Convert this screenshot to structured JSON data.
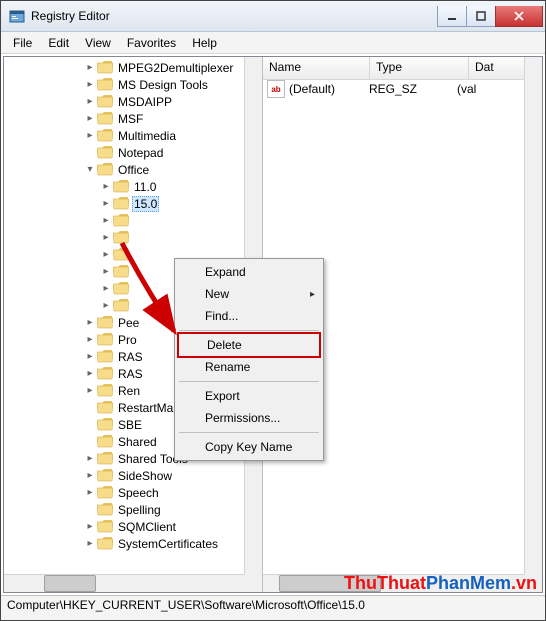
{
  "window": {
    "title": "Registry Editor"
  },
  "menubar": [
    "File",
    "Edit",
    "View",
    "Favorites",
    "Help"
  ],
  "tree": {
    "items": [
      {
        "depth": 5,
        "exp": "closed",
        "label": "MPEG2Demultiplexer"
      },
      {
        "depth": 5,
        "exp": "closed",
        "label": "MS Design Tools"
      },
      {
        "depth": 5,
        "exp": "closed",
        "label": "MSDAIPP"
      },
      {
        "depth": 5,
        "exp": "closed",
        "label": "MSF"
      },
      {
        "depth": 5,
        "exp": "closed",
        "label": "Multimedia"
      },
      {
        "depth": 5,
        "exp": "none",
        "label": "Notepad"
      },
      {
        "depth": 5,
        "exp": "open",
        "label": "Office"
      },
      {
        "depth": 6,
        "exp": "closed",
        "label": "11.0"
      },
      {
        "depth": 6,
        "exp": "closed",
        "label": "15.0",
        "selected": true
      },
      {
        "depth": 6,
        "exp": "closed",
        "label": ""
      },
      {
        "depth": 6,
        "exp": "closed",
        "label": ""
      },
      {
        "depth": 6,
        "exp": "closed",
        "label": ""
      },
      {
        "depth": 6,
        "exp": "closed",
        "label": ""
      },
      {
        "depth": 6,
        "exp": "closed",
        "label": ""
      },
      {
        "depth": 6,
        "exp": "closed",
        "label": ""
      },
      {
        "depth": 5,
        "exp": "closed",
        "label": "Pee"
      },
      {
        "depth": 5,
        "exp": "closed",
        "label": "Pro"
      },
      {
        "depth": 5,
        "exp": "closed",
        "label": "RAS"
      },
      {
        "depth": 5,
        "exp": "closed",
        "label": "RAS"
      },
      {
        "depth": 5,
        "exp": "closed",
        "label": "Ren"
      },
      {
        "depth": 5,
        "exp": "none",
        "label": "RestartManager"
      },
      {
        "depth": 5,
        "exp": "none",
        "label": "SBE"
      },
      {
        "depth": 5,
        "exp": "none",
        "label": "Shared"
      },
      {
        "depth": 5,
        "exp": "closed",
        "label": "Shared Tools"
      },
      {
        "depth": 5,
        "exp": "closed",
        "label": "SideShow"
      },
      {
        "depth": 5,
        "exp": "closed",
        "label": "Speech"
      },
      {
        "depth": 5,
        "exp": "none",
        "label": "Spelling"
      },
      {
        "depth": 5,
        "exp": "closed",
        "label": "SQMClient"
      },
      {
        "depth": 5,
        "exp": "closed",
        "label": "SystemCertificates"
      }
    ]
  },
  "list": {
    "headers": [
      "Name",
      "Type",
      "Dat"
    ],
    "rows": [
      {
        "icon": "ab",
        "name": "(Default)",
        "type": "REG_SZ",
        "data": "(val"
      }
    ]
  },
  "context_menu": {
    "items": [
      {
        "label": "Expand",
        "kind": "item"
      },
      {
        "label": "New",
        "kind": "sub"
      },
      {
        "label": "Find...",
        "kind": "item"
      },
      {
        "kind": "sep"
      },
      {
        "label": "Delete",
        "kind": "item",
        "highlight": true
      },
      {
        "label": "Rename",
        "kind": "item"
      },
      {
        "kind": "sep"
      },
      {
        "label": "Export",
        "kind": "item"
      },
      {
        "label": "Permissions...",
        "kind": "item"
      },
      {
        "kind": "sep"
      },
      {
        "label": "Copy Key Name",
        "kind": "item"
      }
    ]
  },
  "statusbar": "Computer\\HKEY_CURRENT_USER\\Software\\Microsoft\\Office\\15.0",
  "watermark": {
    "part1": "ThuThuat",
    "part2": "PhanMem",
    "part3": ".vn"
  }
}
